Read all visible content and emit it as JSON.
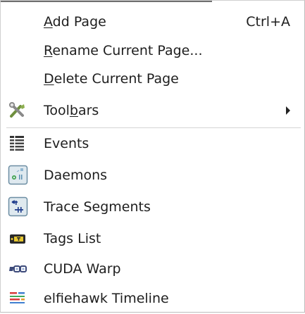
{
  "menu": {
    "items": [
      {
        "label_pre": "",
        "mnemonic": "A",
        "label_post": "dd Page",
        "shortcut": "Ctrl+A",
        "icon": ""
      },
      {
        "label_pre": "",
        "mnemonic": "R",
        "label_post": "ename Current Page...",
        "shortcut": "",
        "icon": ""
      },
      {
        "label_pre": "",
        "mnemonic": "D",
        "label_post": "elete Current Page",
        "shortcut": "",
        "icon": ""
      },
      {
        "label_pre": "Tool",
        "mnemonic": "b",
        "label_post": "ars",
        "shortcut": "",
        "icon": "tools-icon",
        "submenu": true
      },
      {
        "label_pre": "Events",
        "mnemonic": "",
        "label_post": "",
        "shortcut": "",
        "icon": "events-list-icon"
      },
      {
        "label_pre": "Daemons",
        "mnemonic": "",
        "label_post": "",
        "shortcut": "",
        "icon": "daemons-icon"
      },
      {
        "label_pre": "Trace Segments",
        "mnemonic": "",
        "label_post": "",
        "shortcut": "",
        "icon": "trace-segments-icon"
      },
      {
        "label_pre": "Tags List",
        "mnemonic": "",
        "label_post": "",
        "shortcut": "",
        "icon": "tags-list-icon"
      },
      {
        "label_pre": "CUDA Warp",
        "mnemonic": "",
        "label_post": "",
        "shortcut": "",
        "icon": "cuda-warp-icon"
      },
      {
        "label_pre": "elfiehawk Timeline",
        "mnemonic": "",
        "label_post": "",
        "shortcut": "",
        "icon": "timeline-icon"
      }
    ]
  }
}
